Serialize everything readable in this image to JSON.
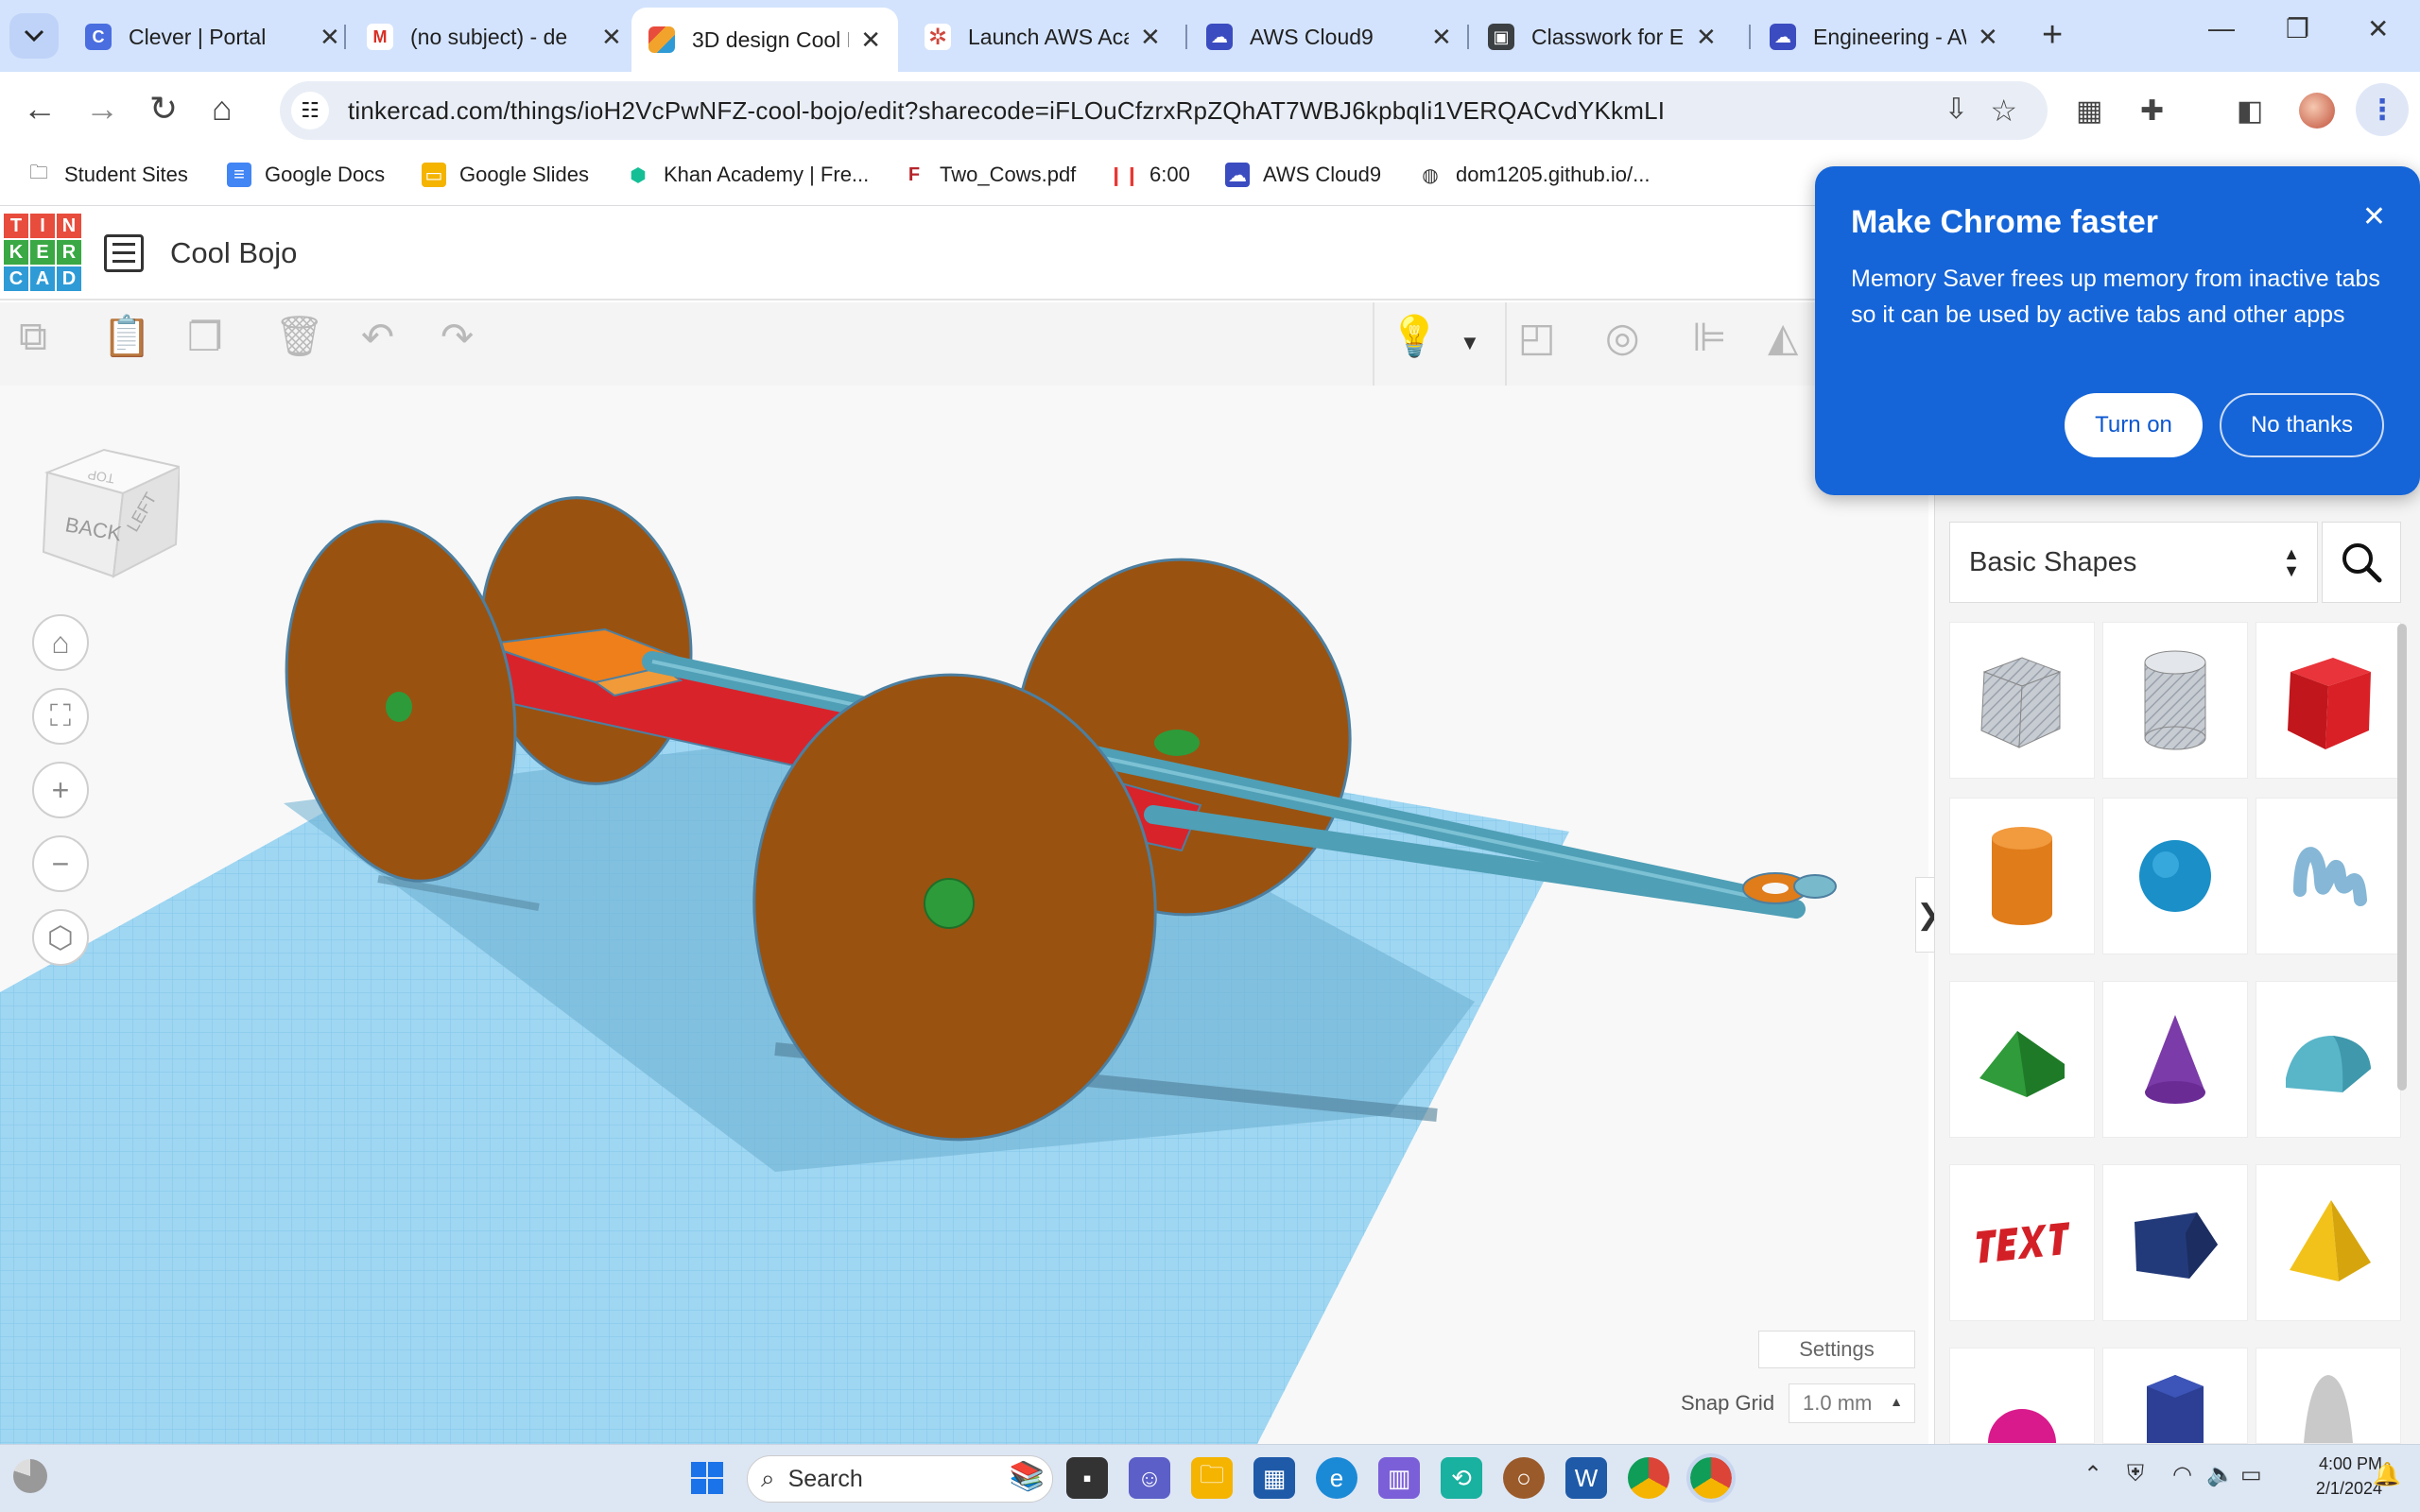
{
  "browser": {
    "tabs": [
      {
        "title": "Clever | Portal",
        "icon": "clever-icon"
      },
      {
        "title": "(no subject) - de",
        "icon": "gmail-icon"
      },
      {
        "title": "3D design Cool B",
        "icon": "tinkercad-icon",
        "active": true
      },
      {
        "title": "Launch AWS Aca",
        "icon": "aws-academy-icon"
      },
      {
        "title": "AWS Cloud9",
        "icon": "cloud9-icon"
      },
      {
        "title": "Classwork for En",
        "icon": "classroom-icon"
      },
      {
        "title": "Engineering - AW",
        "icon": "cloud9-icon"
      }
    ],
    "url": "tinkercad.com/things/ioH2VcPwNFZ-cool-bojo/edit?sharecode=iFLOuCfzrxRpZQhAT7WBJ6kpbqIi1VERQACvdYKkmLI",
    "bookmarks": [
      {
        "label": "Student Sites",
        "icon": "folder-icon"
      },
      {
        "label": "Google Docs",
        "icon": "docs-icon"
      },
      {
        "label": "Google Slides",
        "icon": "slides-icon"
      },
      {
        "label": "Khan Academy | Fre...",
        "icon": "khan-icon"
      },
      {
        "label": "Two_Cows.pdf",
        "icon": "pdf-icon"
      },
      {
        "label": "6:00",
        "icon": "timer-icon"
      },
      {
        "label": "AWS Cloud9",
        "icon": "cloud9-icon"
      },
      {
        "label": "dom1205.github.io/...",
        "icon": "globe-icon"
      }
    ]
  },
  "popup": {
    "title": "Make Chrome faster",
    "body": "Memory Saver frees up memory from inactive tabs so it can be used by active tabs and other apps",
    "turn_on": "Turn on",
    "no_thanks": "No thanks"
  },
  "app": {
    "logo_letters": [
      "T",
      "I",
      "N",
      "K",
      "E",
      "R",
      "C",
      "A",
      "D"
    ],
    "design_title": "Cool Bojo",
    "viewcube": {
      "front": "BACK",
      "side": "LEFT",
      "top": "TOP"
    },
    "settings_label": "Settings",
    "snap_grid_label": "Snap Grid",
    "snap_grid_value": "1.0 mm",
    "shapes_category": "Basic Shapes",
    "shapes": [
      "box-striped",
      "cylinder-striped",
      "box",
      "cylinder",
      "sphere",
      "scribble",
      "roof",
      "cone",
      "round-roof",
      "text",
      "polygon",
      "pyramid",
      "sphere-magenta",
      "hexagonal-prism",
      "paraboloid",
      ""
    ]
  },
  "taskbar": {
    "search_placeholder": "Search",
    "time": "4:00 PM",
    "date": "2/1/2024"
  },
  "colors": {
    "chrome_blue": "#1565d8",
    "wheel": "#9a5210",
    "axle": "#4f9fb6",
    "chassis": "#d8232a",
    "grid": "#8fd0ef"
  }
}
